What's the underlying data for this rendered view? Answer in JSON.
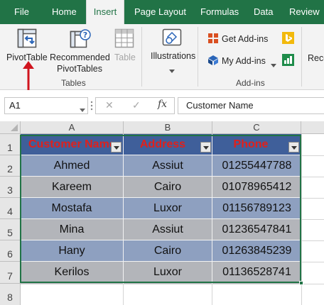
{
  "tabs": [
    "File",
    "Home",
    "Insert",
    "Page Layout",
    "Formulas",
    "Data",
    "Review"
  ],
  "ribbon": {
    "pivot_table": "PivotTable",
    "recommended_line1": "Recommended",
    "recommended_line2": "PivotTables",
    "table": "Table",
    "tables_group": "Tables",
    "illustrations": "Illustrations",
    "get_addins": "Get Add-ins",
    "my_addins": "My Add-ins",
    "addins_group": "Add-ins",
    "reco": "Reco"
  },
  "formula_bar": {
    "name_box": "A1",
    "fx": "fx",
    "cancel": "✕",
    "enter": "✓",
    "content": "Customer Name"
  },
  "columns": [
    "A",
    "B",
    "C"
  ],
  "rows": [
    "1",
    "2",
    "3",
    "4",
    "5",
    "6",
    "7",
    "8"
  ],
  "table": {
    "headers": [
      "Customer Name",
      "Address",
      "Phone"
    ],
    "rows": [
      [
        "Ahmed",
        "Assiut",
        "01255447788"
      ],
      [
        "Kareem",
        "Cairo",
        "01078965412"
      ],
      [
        "Mostafa",
        "Luxor",
        "01156789123"
      ],
      [
        "Mina",
        "Assiut",
        "01236547841"
      ],
      [
        "Hany",
        "Cairo",
        "01263845239"
      ],
      [
        "Kerilos",
        "Luxor",
        "01136528741"
      ]
    ]
  },
  "colors": {
    "excel_green": "#217346",
    "header_fill": "#3f5f9a",
    "header_text": "#e0201c",
    "band_dark": "#8ea0c0",
    "band_light": "#b3b5ba",
    "arrow": "#d0141e"
  }
}
